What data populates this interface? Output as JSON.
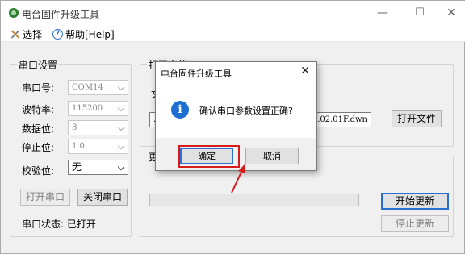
{
  "window": {
    "title": "电台固件升级工具"
  },
  "menu": {
    "items": [
      "选择",
      "帮助[Help]"
    ]
  },
  "serial": {
    "group_title": "串口设置",
    "port": {
      "label": "串口号:",
      "value": "COM14"
    },
    "baud": {
      "label": "波特率:",
      "value": "115200"
    },
    "databits": {
      "label": "数据位:",
      "value": "8"
    },
    "stopbits": {
      "label": "停止位:",
      "value": "1.0"
    },
    "parity": {
      "label": "校验位:",
      "value": "无"
    },
    "open_btn": "打开串口",
    "close_btn": "关闭串口",
    "status": "串口状态: 已打开"
  },
  "open_file": {
    "group_title": "打开文件",
    "file_label": "文",
    "path_prefix": ".",
    "path_suffix": "1.02.01F.dwn",
    "open_btn": "打开文件"
  },
  "update": {
    "group_title": "更新",
    "start_btn": "开始更新",
    "stop_btn": "停止更新"
  },
  "dialog": {
    "title": "电台固件升级工具",
    "message": "确认串口参数设置正确?",
    "ok": "确定",
    "cancel": "取消"
  },
  "colors": {
    "accent": "#2a6fd6",
    "highlight": "#d71a1a",
    "info": "#1c6fd1"
  }
}
